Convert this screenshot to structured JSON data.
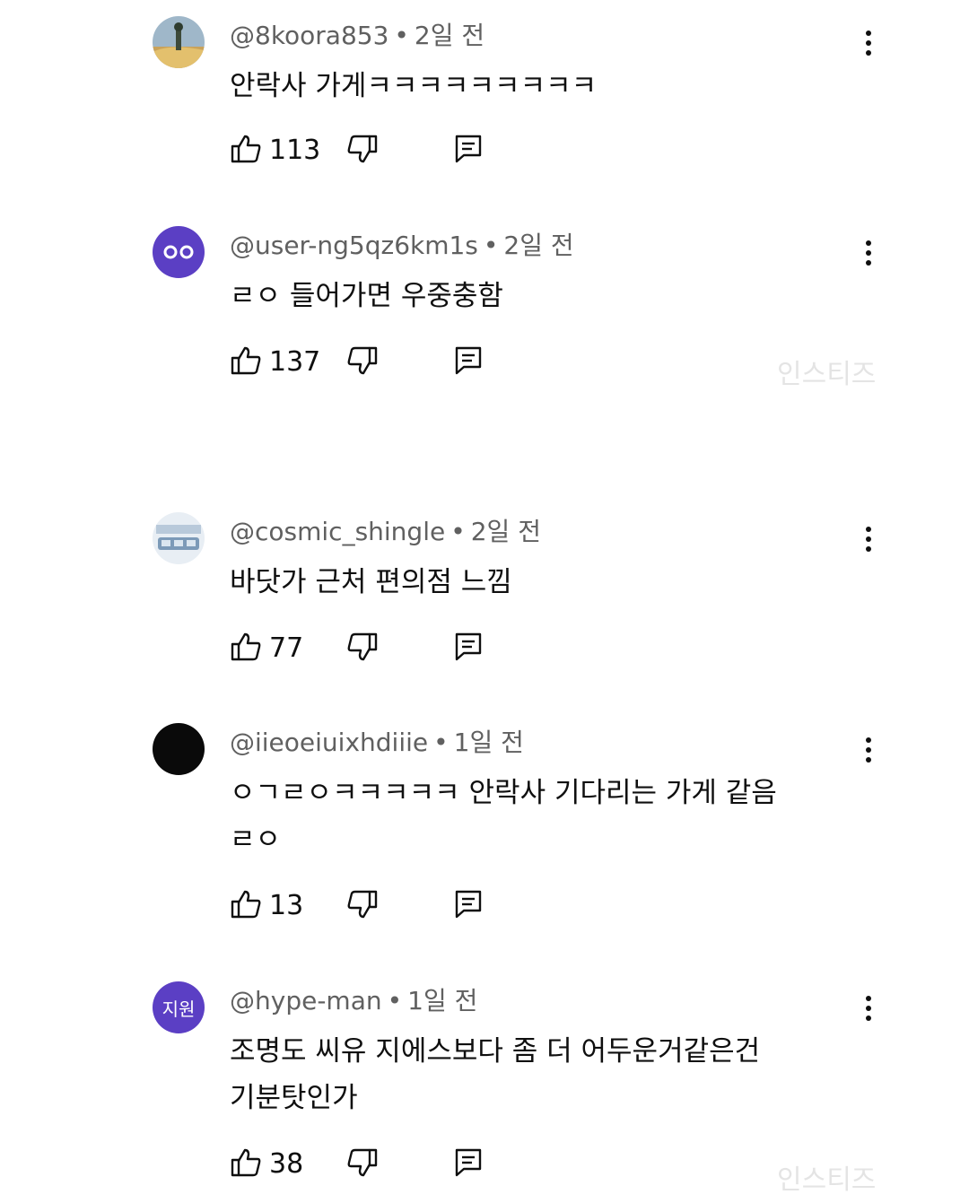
{
  "comments": [
    {
      "username": "@8koora853",
      "age": "2일 전",
      "text": "안락사 가게ㅋㅋㅋㅋㅋㅋㅋㅋㅋ",
      "likes": "113",
      "avatar_icon": "landscape-avatar-icon"
    },
    {
      "username": "@user-ng5qz6km1s",
      "age": "2일 전",
      "text": "ㄹㅇ 들어가면 우중충함",
      "likes": "137",
      "avatar_icon": "purple-eyes-avatar-icon"
    },
    {
      "username": "@cosmic_shingle",
      "age": "2일 전",
      "text": "바닷가 근처 편의점 느낌",
      "likes": "77",
      "avatar_icon": "image-avatar-icon"
    },
    {
      "username": "@iieoeiuixhdiiie",
      "age": "1일 전",
      "text": "ㅇㄱㄹㅇㅋㅋㅋㅋㅋ 안락사 기다리는 가게 같음\nㄹㅇ",
      "likes": "13",
      "avatar_icon": "black-avatar-icon"
    },
    {
      "username": "@hype-man",
      "age": "1일 전",
      "text": "조명도 씨유 지에스보다 좀 더 어두운거같은건\n기분탓인가",
      "likes": "38",
      "avatar_icon": "letter-avatar-icon",
      "avatar_letters": "지원"
    }
  ],
  "separator": "•",
  "watermark": "인스티즈",
  "colors": {
    "avatar_purple": "#5b3fc4",
    "meta_text": "#606060",
    "body_text": "#0f0f0f"
  }
}
